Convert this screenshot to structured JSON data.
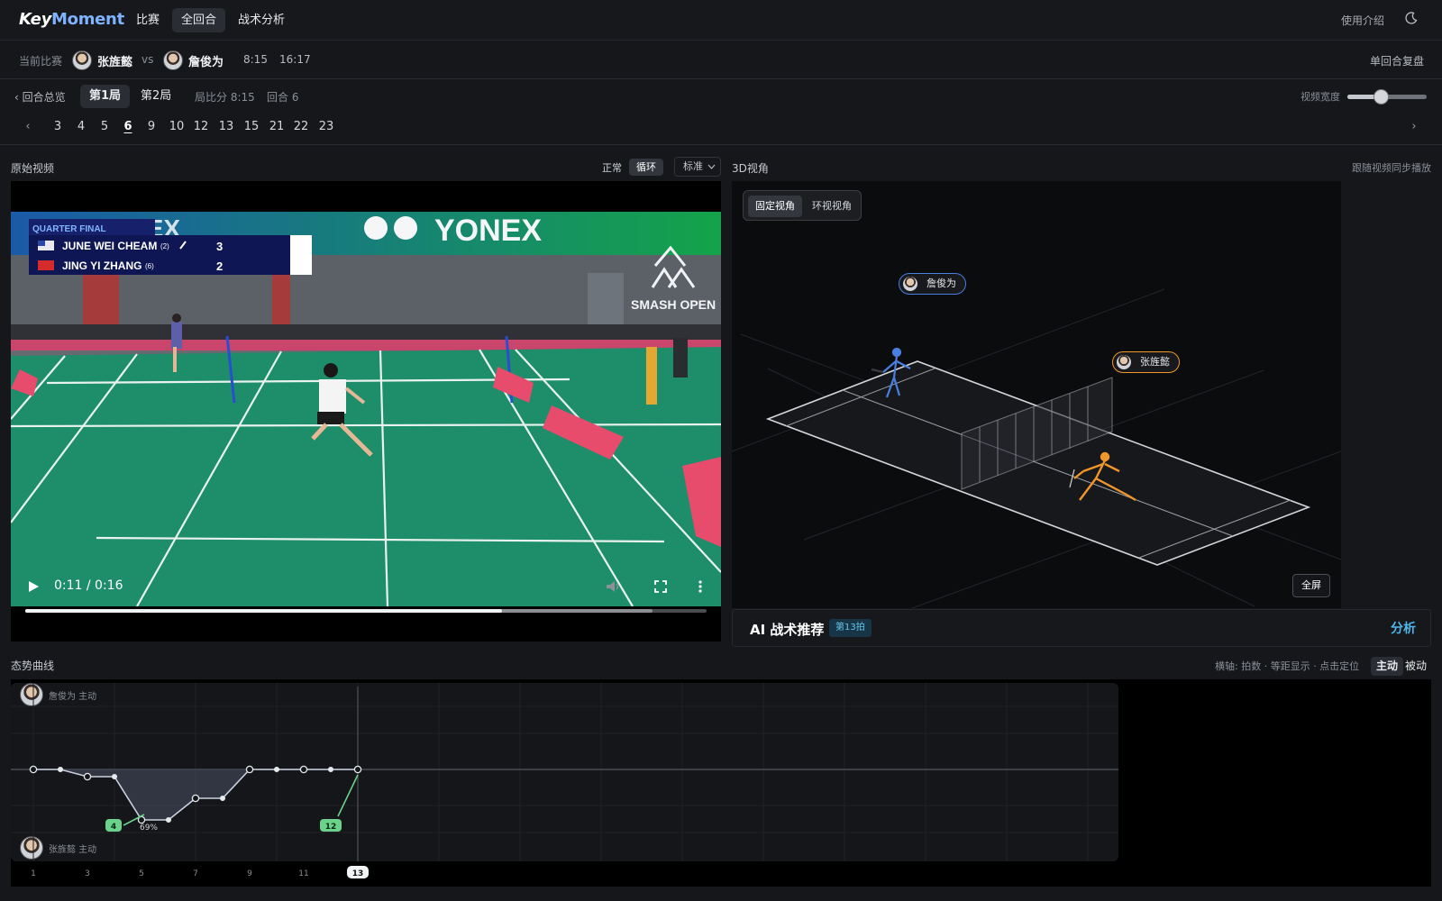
{
  "app": {
    "logo_key": "Key",
    "logo_moment": "Moment"
  },
  "nav": {
    "items": [
      "比赛",
      "全回合",
      "战术分析"
    ],
    "active": 1
  },
  "header": {
    "help": "使用介绍"
  },
  "match": {
    "label": "当前比赛",
    "player1": "张旌懿",
    "vs": "vs",
    "player2": "詹俊为",
    "score1": "8:15",
    "score2": "16:17",
    "single_review": "单回合复盘"
  },
  "game": {
    "back": "‹ 回合总览",
    "tabs": [
      "第1局",
      "第2局"
    ],
    "game_score": "局比分 8:15",
    "rally": "回合 6",
    "width_label": "视频宽度",
    "width_value": 0.42
  },
  "rallies": {
    "items": [
      "3",
      "4",
      "5",
      "6",
      "9",
      "10",
      "12",
      "13",
      "15",
      "21",
      "22",
      "23"
    ],
    "active": "6",
    "prev": "‹",
    "next": "›"
  },
  "video": {
    "title": "原始视频",
    "speed_normal": "正常",
    "speed_loop": "循环",
    "quality": "标准",
    "time": "0:11 / 0:16",
    "progress": 0.7,
    "buffered": 0.92,
    "scoreboard": {
      "round": "QUARTER FINAL",
      "row1_name": "JUNE WEI CHEAM",
      "row1_seed": "(2)",
      "row1_score": "3",
      "row2_name": "JING YI ZHANG",
      "row2_seed": "(6)",
      "row2_score": "2"
    },
    "brand1": "YONEX",
    "brand2": "YONEX",
    "event": "SMASH OPEN"
  },
  "view3d": {
    "title": "3D视角",
    "sync": "跟随视频同步播放",
    "fixed": "固定视角",
    "orbit": "环视视角",
    "tag_far": "詹俊为",
    "tag_near": "张旌懿",
    "fullscreen": "全屏",
    "colors": {
      "far_player": "#4a7fe0",
      "near_player": "#f0962a"
    }
  },
  "ai": {
    "title": "AI 战术推荐",
    "badge": "第13拍",
    "action": "分析"
  },
  "trend": {
    "title": "态势曲线",
    "axis_note": "横轴: 拍数 · 等距显示 · 点击定位",
    "active_mode": "主动",
    "passive_mode": "被动",
    "top_label": "詹俊为 主动",
    "bottom_label": "张旌懿 主动",
    "x_ticks": [
      "1",
      "3",
      "5",
      "7",
      "9",
      "11",
      "13"
    ],
    "badge_a": "4",
    "badge_pct": "69%",
    "badge_b": "12"
  },
  "chart_data": {
    "type": "line",
    "x": [
      1,
      2,
      3,
      4,
      5,
      6,
      7,
      8,
      9,
      10,
      11,
      12,
      13
    ],
    "series": [
      {
        "values": [
          0,
          0,
          -0.1,
          -0.1,
          -0.7,
          -0.7,
          -0.4,
          -0.4,
          0,
          0,
          0,
          0,
          0
        ]
      }
    ],
    "ylim": [
      -1,
      1
    ],
    "current": 13
  }
}
